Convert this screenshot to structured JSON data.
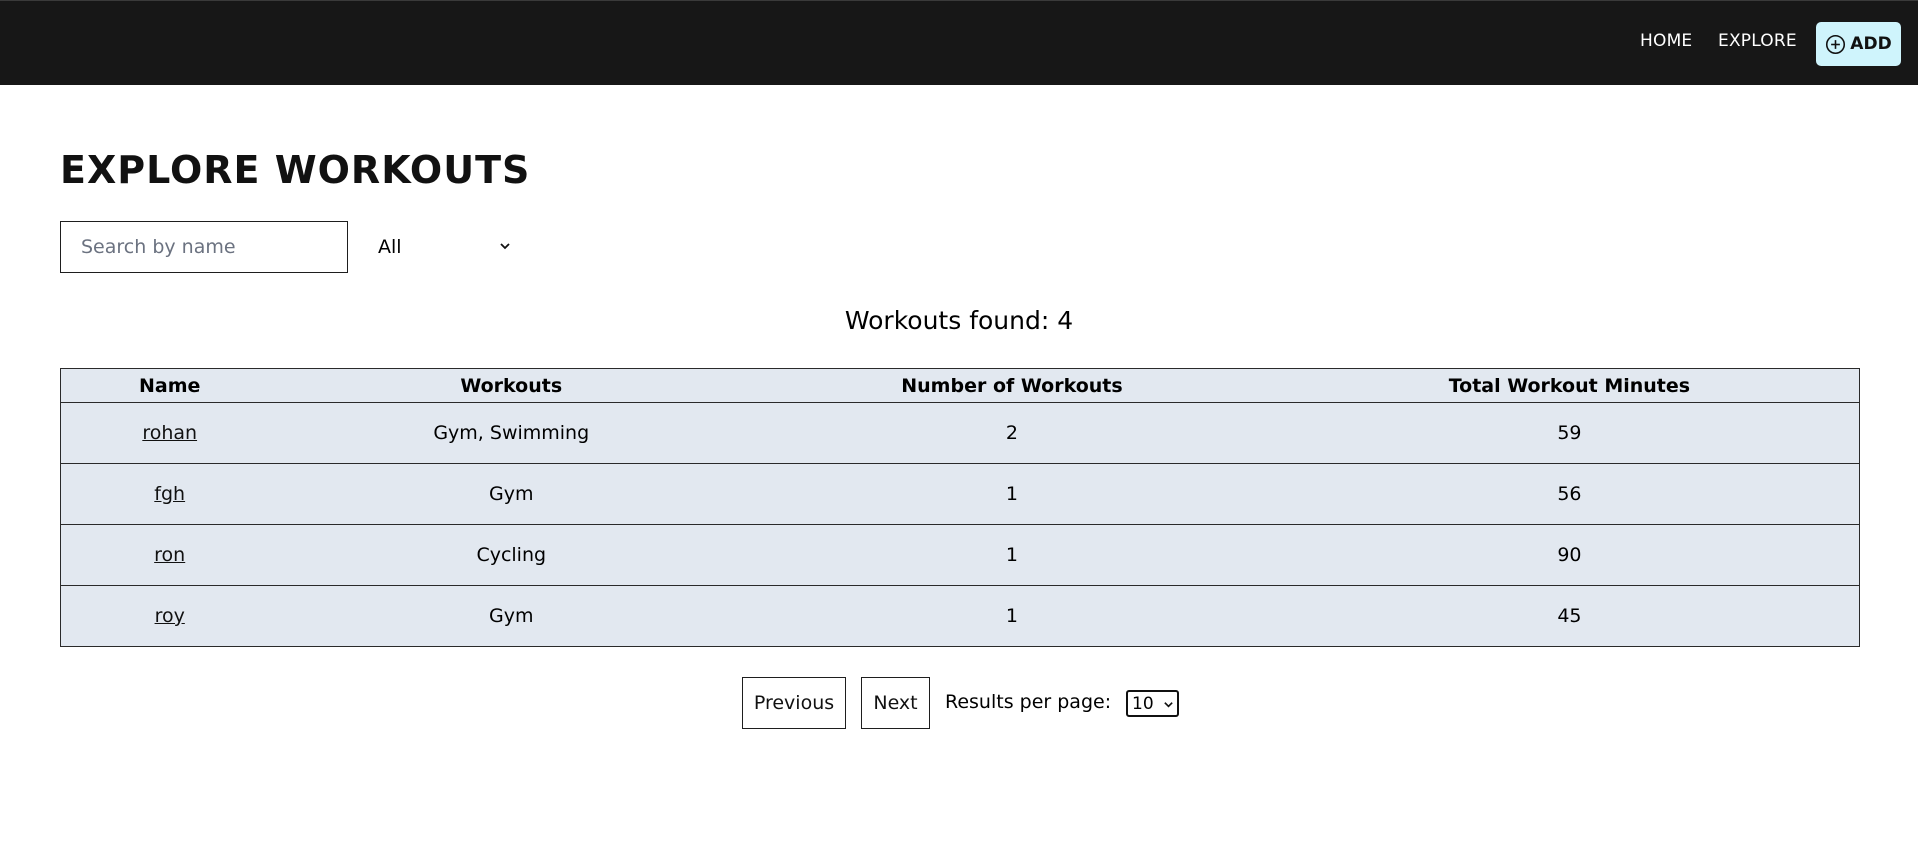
{
  "nav": {
    "home_label": "HOME",
    "explore_label": "EXPLORE",
    "add_label": "ADD",
    "add_icon": "plus-circle-icon"
  },
  "page": {
    "title": "EXPLORE WORKOUTS"
  },
  "filters": {
    "search_placeholder": "Search by name",
    "search_value": "",
    "type_selected": "All"
  },
  "results": {
    "count_text": "Workouts found: 4"
  },
  "table": {
    "headers": [
      "Name",
      "Workouts",
      "Number of Workouts",
      "Total Workout Minutes"
    ],
    "rows": [
      {
        "name": "rohan",
        "workouts": "Gym, Swimming",
        "count": "2",
        "minutes": "59"
      },
      {
        "name": "fgh",
        "workouts": "Gym",
        "count": "1",
        "minutes": "56"
      },
      {
        "name": "ron",
        "workouts": "Cycling",
        "count": "1",
        "minutes": "90"
      },
      {
        "name": "roy",
        "workouts": "Gym",
        "count": "1",
        "minutes": "45"
      }
    ]
  },
  "pagination": {
    "previous_label": "Previous",
    "next_label": "Next",
    "per_page_label": "Results per page:",
    "per_page_value": "10"
  },
  "colors": {
    "topbar": "#171717",
    "add_button": "#cff4fc",
    "table_bg": "#e2e8f0"
  }
}
